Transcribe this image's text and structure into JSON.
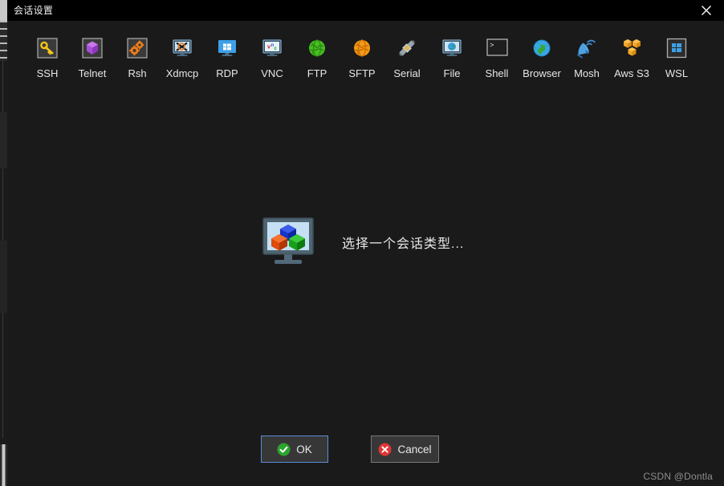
{
  "window": {
    "title": "会话设置",
    "close_label": "×",
    "close_icon": "close-icon"
  },
  "toolbar": {
    "items": [
      {
        "label": "SSH",
        "icon": "key-icon"
      },
      {
        "label": "Telnet",
        "icon": "purple-cube-icon"
      },
      {
        "label": "Rsh",
        "icon": "gears-icon"
      },
      {
        "label": "Xdmcp",
        "icon": "x-monitor-icon"
      },
      {
        "label": "RDP",
        "icon": "windows-monitor-icon"
      },
      {
        "label": "VNC",
        "icon": "vnc-monitor-icon"
      },
      {
        "label": "FTP",
        "icon": "green-globe-icon"
      },
      {
        "label": "SFTP",
        "icon": "orange-globe-icon"
      },
      {
        "label": "Serial",
        "icon": "serial-connector-icon"
      },
      {
        "label": "File",
        "icon": "file-globe-monitor-icon"
      },
      {
        "label": "Shell",
        "icon": "terminal-prompt-icon"
      },
      {
        "label": "Browser",
        "icon": "blue-globe-icon"
      },
      {
        "label": "Mosh",
        "icon": "satellite-dish-icon"
      },
      {
        "label": "Aws S3",
        "icon": "aws-cubes-icon"
      },
      {
        "label": "WSL",
        "icon": "wsl-windows-icon"
      }
    ]
  },
  "main": {
    "placeholder_text": "选择一个会话类型...",
    "placeholder_icon": "monitor-cubes-icon"
  },
  "footer": {
    "ok_label": "OK",
    "ok_icon": "green-check-icon",
    "cancel_label": "Cancel",
    "cancel_icon": "red-x-icon"
  },
  "watermark": {
    "text": "CSDN @Dontla"
  },
  "colors": {
    "dialog_background": "#1a1a1a",
    "titlebar_background": "#000000",
    "label_text": "#e6e6e6",
    "focus_border": "#5b8dd9",
    "button_background": "#373737",
    "watermark_text": "#8d8d8d"
  }
}
